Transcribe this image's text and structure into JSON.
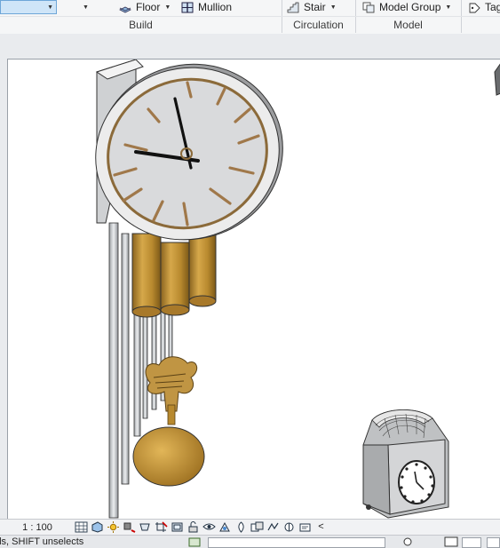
{
  "ribbon": {
    "buttons": {
      "floor": "Floor",
      "mullion": "Mullion",
      "stair": "Stair",
      "model_group": "Model  Group",
      "tag": "Tag"
    },
    "panels": {
      "build": "Build",
      "circulation": "Circulation",
      "model": "Model"
    }
  },
  "view_control_bar": {
    "scale": "1 : 100",
    "icons": [
      "detail-level-icon",
      "visual-style-icon",
      "sun-path-icon",
      "shadows-icon",
      "render-icon",
      "crop-view-icon",
      "show-crop-icon",
      "unlock-3d-icon",
      "temporary-hide-icon",
      "reveal-hidden-icon",
      "analytical-model-icon",
      "highlight-displacement-icon",
      "reveal-constraints-icon",
      "design-options-icon",
      "worksharing-icon",
      "collapse-arrow-icon"
    ],
    "collapse_glyph": "<"
  },
  "status_bar": {
    "text": "lds, SHIFT unselects"
  },
  "colors": {
    "brass": "#b8892e",
    "clock_face": "#d9dadc",
    "wood_dark": "#7a5a2a",
    "ribbon_bg": "#f5f6f7",
    "selected_blue": "#cfe5f8"
  }
}
